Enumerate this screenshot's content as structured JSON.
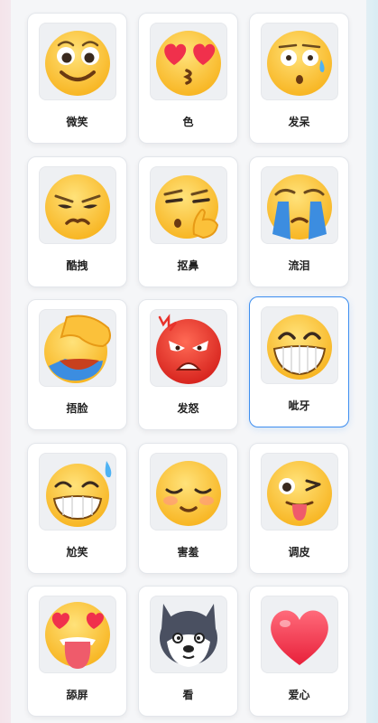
{
  "emojis": [
    {
      "label": "微笑",
      "icon": "smile-icon",
      "selected": false
    },
    {
      "label": "色",
      "icon": "heart-eyes-kiss-icon",
      "selected": false
    },
    {
      "label": "发呆",
      "icon": "daze-icon",
      "selected": false
    },
    {
      "label": "酷拽",
      "icon": "cool-smug-icon",
      "selected": false
    },
    {
      "label": "抠鼻",
      "icon": "pick-nose-icon",
      "selected": false
    },
    {
      "label": "流泪",
      "icon": "crying-icon",
      "selected": false
    },
    {
      "label": "捂脸",
      "icon": "facepalm-icon",
      "selected": false
    },
    {
      "label": "发怒",
      "icon": "angry-icon",
      "selected": false
    },
    {
      "label": "呲牙",
      "icon": "grin-teeth-icon",
      "selected": true
    },
    {
      "label": "尬笑",
      "icon": "awkward-smile-icon",
      "selected": false
    },
    {
      "label": "害羞",
      "icon": "shy-icon",
      "selected": false
    },
    {
      "label": "调皮",
      "icon": "wink-tongue-icon",
      "selected": false
    },
    {
      "label": "舔屏",
      "icon": "lick-screen-icon",
      "selected": false
    },
    {
      "label": "看",
      "icon": "husky-look-icon",
      "selected": false
    },
    {
      "label": "爱心",
      "icon": "heart-icon",
      "selected": false
    }
  ],
  "colors": {
    "selected_border": "#3d8ef0",
    "face": "#ffc93a",
    "angry_face": "#e8322b",
    "heart": "#f0304c"
  }
}
